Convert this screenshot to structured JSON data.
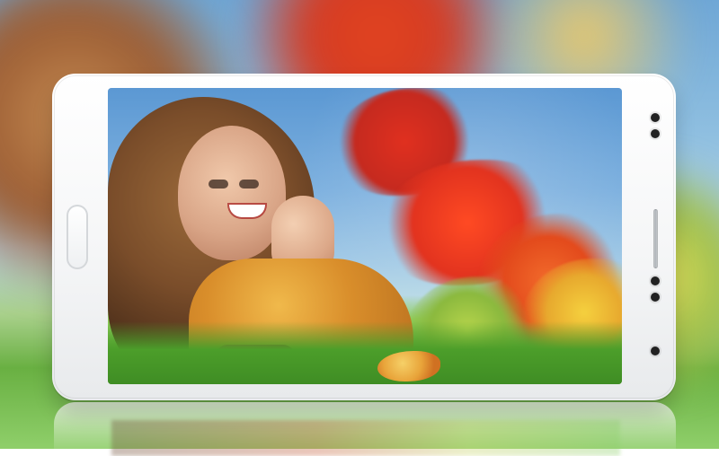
{
  "scene": {
    "type": "product-photo",
    "subject": "smartphone-in-landscape-with-photo-on-screen",
    "colors": {
      "background_sky": "#7eb1df",
      "foliage_red": "#e2331f",
      "grass_green": "#4c9e2a",
      "phone_body": "#f5f6f7"
    }
  }
}
